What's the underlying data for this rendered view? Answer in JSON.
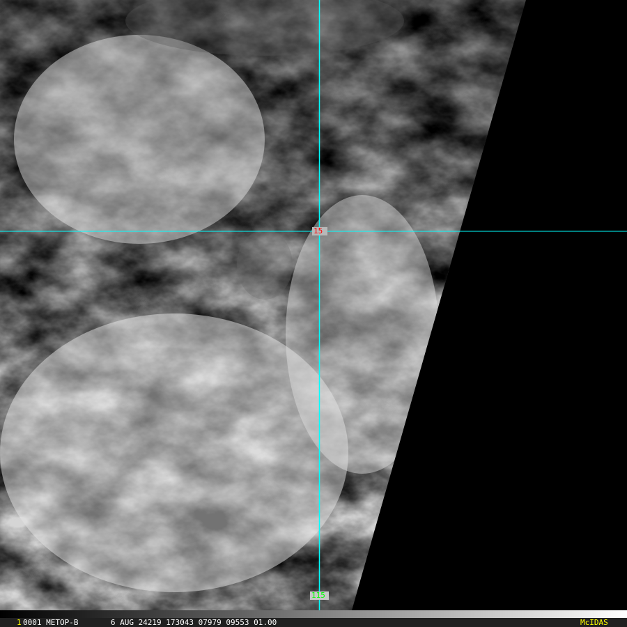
{
  "image": {
    "lat_label": "15",
    "lon_label": "115",
    "line_color": "#00ffff",
    "lat_label_color": "#ff0000",
    "lon_label_color": "#00ff00"
  },
  "info_bar": {
    "frame_number": "1",
    "text": "0001 METOP-B       6 AUG 24219 173043 07979 09553 01.00",
    "brand": "McIDAS",
    "brand_color": "#ffff00"
  }
}
